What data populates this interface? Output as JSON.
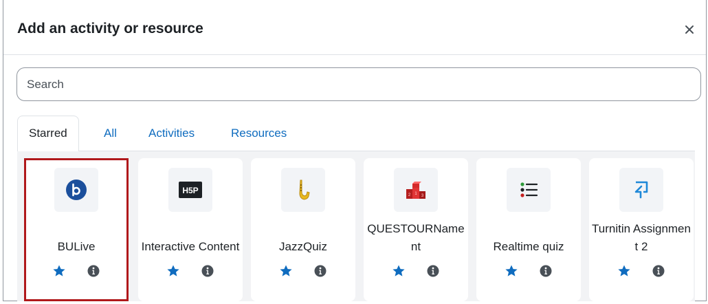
{
  "modal": {
    "title": "Add an activity or resource",
    "close_label": "×"
  },
  "search": {
    "placeholder": "Search",
    "value": ""
  },
  "tabs": [
    {
      "label": "Starred",
      "active": true
    },
    {
      "label": "All",
      "active": false
    },
    {
      "label": "Activities",
      "active": false
    },
    {
      "label": "Resources",
      "active": false
    }
  ],
  "items": [
    {
      "name": "BULive",
      "icon": "bulive-icon",
      "starred": true,
      "selected": true
    },
    {
      "name": "Interactive Content",
      "icon": "h5p-icon",
      "starred": true,
      "selected": false
    },
    {
      "name": "JazzQuiz",
      "icon": "saxophone-icon",
      "starred": true,
      "selected": false
    },
    {
      "name": "QUESTOURNament",
      "icon": "podium-icon",
      "starred": true,
      "selected": false
    },
    {
      "name": "Realtime quiz",
      "icon": "list-icon",
      "starred": true,
      "selected": false
    },
    {
      "name": "Turnitin Assignment 2",
      "icon": "turnitin-icon",
      "starred": true,
      "selected": false
    }
  ],
  "colors": {
    "accent": "#0f6cbf",
    "highlight": "#b0181b",
    "text": "#1d2125",
    "grid_bg": "#f2f3f5"
  }
}
